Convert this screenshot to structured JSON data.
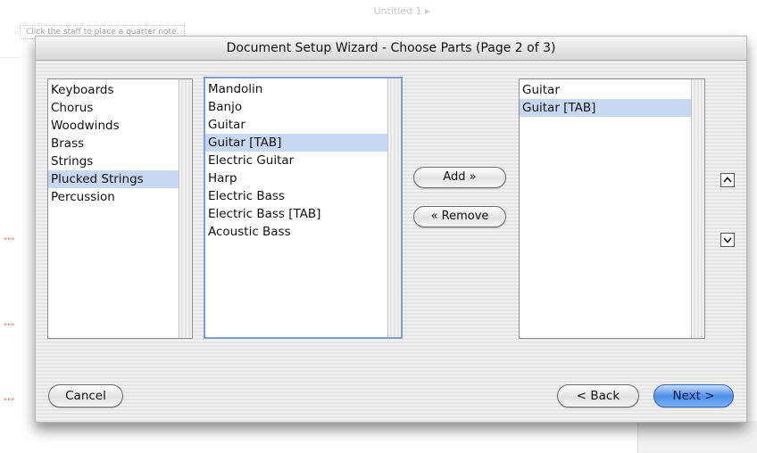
{
  "background": {
    "window_title": "Untitled 1 ▸",
    "status_hint": "Click the staff to place a quarter note.",
    "margin_marks": [
      "\"\"\"",
      "\"\"\"",
      "\"\"\""
    ]
  },
  "dialog": {
    "title": "Document Setup Wizard - Choose Parts (Page 2 of 3)"
  },
  "families": {
    "items": [
      "Keyboards",
      "Chorus",
      "Woodwinds",
      "Brass",
      "Strings",
      "Plucked Strings",
      "Percussion"
    ],
    "selected_index": 5
  },
  "instruments": {
    "items": [
      "Mandolin",
      "Banjo",
      "Guitar",
      "Guitar [TAB]",
      "Electric Guitar",
      "Harp",
      "Electric Bass",
      "Electric Bass [TAB]",
      "Acoustic Bass"
    ],
    "selected_index": 3
  },
  "buttons": {
    "add": "Add »",
    "remove": "« Remove",
    "cancel": "Cancel",
    "back": "< Back",
    "next": "Next >"
  },
  "parts": {
    "items": [
      "Guitar",
      "Guitar [TAB]"
    ],
    "selected_index": 1
  },
  "colors": {
    "selection": "#c8d7f2",
    "default_button": "#4f8fea",
    "focus_ring": "#7f9ed8"
  }
}
